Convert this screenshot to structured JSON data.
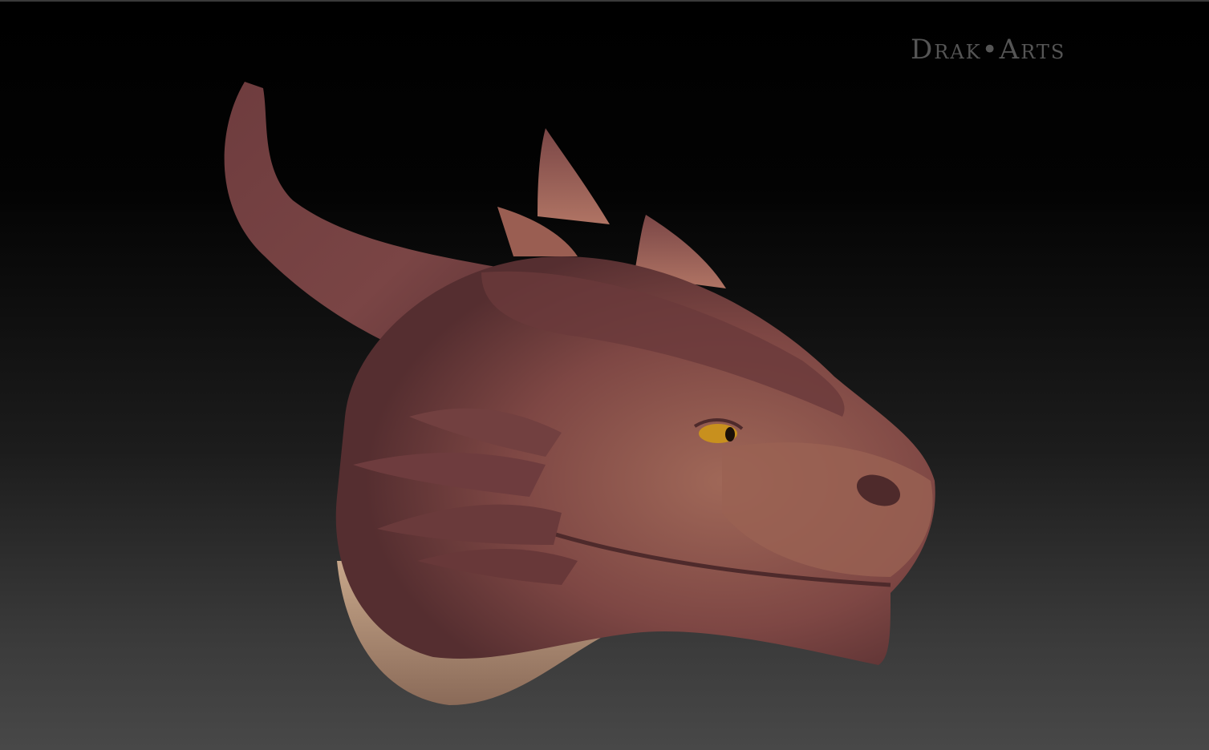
{
  "watermark": {
    "text": "Drak•Arts"
  },
  "colors": {
    "skin": "#8a4f48",
    "shadow": "#4e2a2b",
    "highlight": "#b07464",
    "belly": "#b8957a",
    "eye": "#c8901e"
  }
}
